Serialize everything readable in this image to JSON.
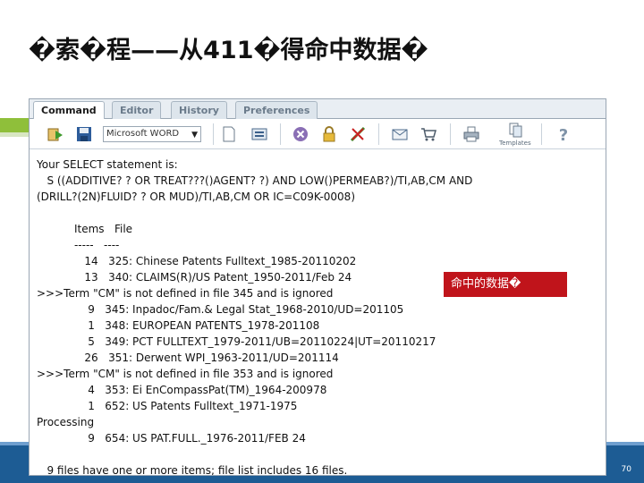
{
  "slide": {
    "title": "�索�程——从411�得命中数据�",
    "page_number": "70"
  },
  "app": {
    "tabs": [
      {
        "label": "Command",
        "active": true
      },
      {
        "label": "Editor",
        "active": false
      },
      {
        "label": "History",
        "active": false
      },
      {
        "label": "Preferences",
        "active": false
      }
    ],
    "toolbar": {
      "format_value": "Microsoft WORD",
      "templates_label": "Templates",
      "icons": [
        "run-icon",
        "save-icon",
        "new-document-icon",
        "print-preview-icon",
        "cancel-icon",
        "lock-icon",
        "disconnect-icon",
        "email-icon",
        "cart-icon",
        "printer-icon",
        "templates-icon",
        "help-icon"
      ]
    },
    "console_lines": [
      "Your SELECT statement is:",
      "   S ((ADDITIVE? ? OR TREAT???()AGENT? ?) AND LOW()PERMEAB?)/TI,AB,CM AND",
      "(DRILL?(2N)FLUID? ? OR MUD)/TI,AB,CM OR IC=C09K-0008)",
      "",
      "           Items   File",
      "           -----   ----",
      "              14   325: Chinese Patents Fulltext_1985-20110202",
      "              13   340: CLAIMS(R)/US Patent_1950-2011/Feb 24",
      ">>>Term \"CM\" is not defined in file 345 and is ignored",
      "               9   345: Inpadoc/Fam.& Legal Stat_1968-2010/UD=201105",
      "               1   348: EUROPEAN PATENTS_1978-201108",
      "               5   349: PCT FULLTEXT_1979-2011/UB=20110224|UT=20110217",
      "              26   351: Derwent WPI_1963-2011/UD=201114",
      ">>>Term \"CM\" is not defined in file 353 and is ignored",
      "               4   353: Ei EnCompassPat(TM)_1964-200978",
      "               1   652: US Patents Fulltext_1971-1975",
      "Processing",
      "               9   654: US PAT.FULL._1976-2011/FEB 24",
      "",
      "   9 files have one or more items; file list includes 16 files."
    ],
    "callout_label": "命中的数据�"
  },
  "colors": {
    "accent_red": "#c0141b",
    "footer_blue": "#1d5c94",
    "stripe_green": "#8fbf3a"
  }
}
